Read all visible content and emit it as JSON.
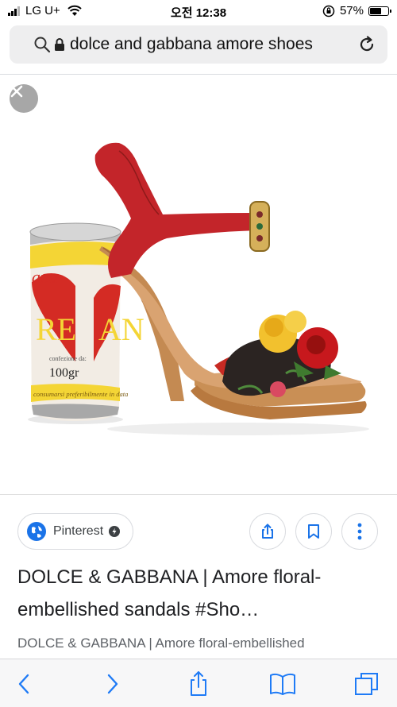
{
  "status_bar": {
    "carrier": "LG U+",
    "time": "오전 12:38",
    "battery": "57%",
    "battery_level": 0.57
  },
  "url_bar": {
    "query": "dolce and gabbana amore shoes"
  },
  "result": {
    "source_chip": "Pinterest",
    "title": "DOLCE & GABBANA | Amore floral-embellished sandals #Sho…",
    "subtitle": "DOLCE & GABBANA | Amore floral-embellished",
    "can_text": {
      "brand": "ana",
      "letters_left": "RE",
      "letters_right": "AN",
      "small": "confezione da:",
      "weight": "100gr",
      "band": "consumarsi preferibilmente in data"
    }
  },
  "colors": {
    "accent_blue": "#1a73e8",
    "ios_blue": "#1f7bf6",
    "close_gray": "#a7a7a7"
  },
  "icons": {
    "search": "search-icon",
    "lock": "lock-icon",
    "reload": "reload-icon",
    "close": "close-icon",
    "share": "share-icon",
    "bookmark": "bookmark-icon",
    "more": "more-vert-icon",
    "back": "back-icon",
    "forward": "forward-icon",
    "books": "books-icon",
    "tabs": "tabs-icon"
  }
}
